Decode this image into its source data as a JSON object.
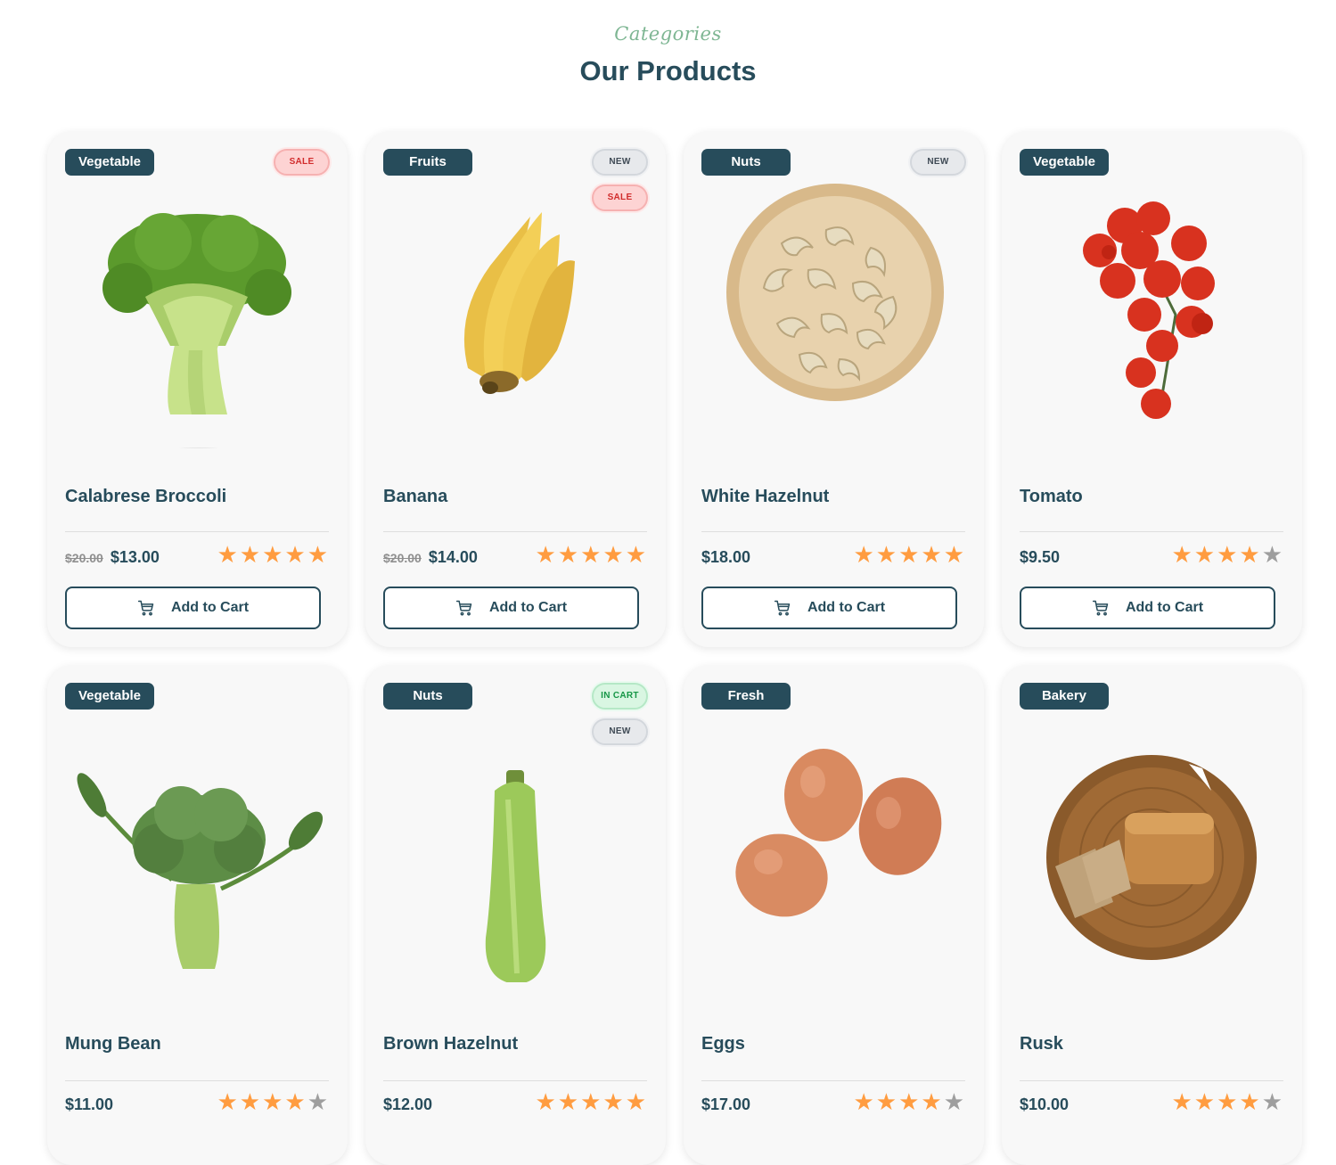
{
  "header": {
    "subtitle": "Categories",
    "title": "Our Products"
  },
  "colors": {
    "primary": "#274c5b",
    "accent_green": "#7eb693",
    "star": "#ff9c40",
    "card_bg": "#f8f8f8"
  },
  "products": [
    {
      "category": "Vegetable",
      "badges": [
        "SALE"
      ],
      "name": "Calabrese Broccoli",
      "old_price": "$20.00",
      "price": "$13.00",
      "rating": 5,
      "button": "Add to Cart",
      "image_icon": "broccoli-image"
    },
    {
      "category": "Fruits",
      "badges": [
        "NEW",
        "SALE"
      ],
      "name": "Banana",
      "old_price": "$20.00",
      "price": "$14.00",
      "rating": 5,
      "button": "Add to Cart",
      "image_icon": "banana-image"
    },
    {
      "category": "Nuts",
      "badges": [
        "NEW"
      ],
      "name": "White Hazelnut",
      "old_price": "",
      "price": "$18.00",
      "rating": 5,
      "button": "Add to Cart",
      "image_icon": "cashew-bowl-image"
    },
    {
      "category": "Vegetable",
      "badges": [],
      "name": "Tomato",
      "old_price": "",
      "price": "$9.50",
      "rating": 4,
      "button": "Add to Cart",
      "image_icon": "tomato-image"
    },
    {
      "category": "Vegetable",
      "badges": [],
      "name": "Mung Bean",
      "old_price": "",
      "price": "$11.00",
      "rating": 4,
      "button": "",
      "image_icon": "broccoli-leaves-image"
    },
    {
      "category": "Nuts",
      "badges": [
        "IN CART",
        "NEW"
      ],
      "name": "Brown Hazelnut",
      "old_price": "",
      "price": "$12.00",
      "rating": 5,
      "button": "",
      "image_icon": "zucchini-image"
    },
    {
      "category": "Fresh",
      "badges": [],
      "name": "Eggs",
      "old_price": "",
      "price": "$17.00",
      "rating": 4,
      "button": "",
      "image_icon": "eggs-image"
    },
    {
      "category": "Bakery",
      "badges": [],
      "name": "Rusk",
      "old_price": "",
      "price": "$10.00",
      "rating": 4,
      "button": "",
      "image_icon": "bread-board-image"
    }
  ]
}
